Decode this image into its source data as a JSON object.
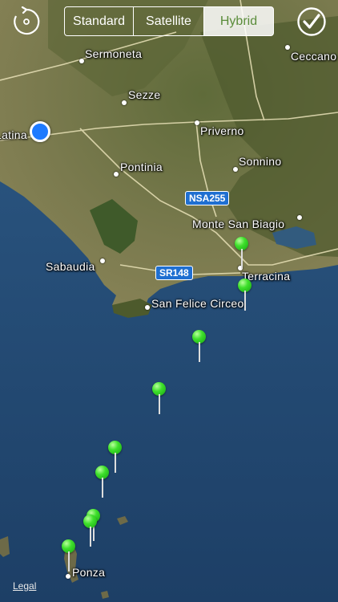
{
  "toolbar": {
    "segments": [
      "Standard",
      "Satellite",
      "Hybrid"
    ],
    "selected": "Hybrid"
  },
  "icons": {
    "refresh": "refresh-location-icon",
    "done": "checkmark-icon"
  },
  "places": [
    "Sermoneta",
    "Sezze",
    "Latina",
    "Priverno",
    "Ceccano",
    "Pontinia",
    "Sonnino",
    "Monte San Biagio",
    "Sabaudia",
    "Terracina",
    "San Felice Circeo",
    "Ponza"
  ],
  "roads": [
    "NSA255",
    "SR148"
  ],
  "legal": "Legal",
  "colors": {
    "pin": "#3ee02b",
    "location": "#1e7bff",
    "shield": "#1f6fd1",
    "selected_text": "#5a8c3a"
  }
}
